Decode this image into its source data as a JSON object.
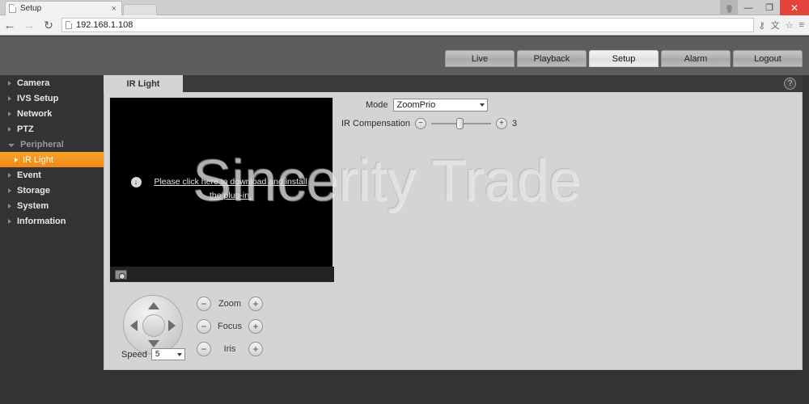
{
  "browser": {
    "tab_title": "Setup",
    "tab_close": "×",
    "url": "192.168.1.108",
    "back_icon": "←",
    "forward_icon": "→",
    "reload_icon": "↻",
    "minimize_icon": "—",
    "maximize_icon": "❐",
    "close_icon": "✕",
    "key_icon": "⚷",
    "translate_icon": "文",
    "star_icon": "☆",
    "menu_icon": "≡"
  },
  "device": {
    "logo": "",
    "topnav": [
      {
        "label": "Live",
        "active": false
      },
      {
        "label": "Playback",
        "active": false
      },
      {
        "label": "Setup",
        "active": true
      },
      {
        "label": "Alarm",
        "active": false
      },
      {
        "label": "Logout",
        "active": false
      }
    ],
    "help_icon": "?"
  },
  "sidebar": {
    "items": [
      {
        "label": "Camera",
        "type": "parent"
      },
      {
        "label": "IVS Setup",
        "type": "parent"
      },
      {
        "label": "Network",
        "type": "parent"
      },
      {
        "label": "PTZ",
        "type": "parent"
      },
      {
        "label": "Peripheral",
        "type": "expanded"
      },
      {
        "label": "IR Light",
        "type": "child-selected"
      },
      {
        "label": "Event",
        "type": "parent"
      },
      {
        "label": "Storage",
        "type": "parent"
      },
      {
        "label": "System",
        "type": "parent"
      },
      {
        "label": "Information",
        "type": "parent"
      }
    ]
  },
  "content": {
    "tab_label": "IR Light",
    "video": {
      "plugin_message": "Please click here to download and install the plug-in.",
      "download_icon": "↓",
      "snapshot_icon": "snapshot"
    },
    "settings": {
      "mode_label": "Mode",
      "mode_value": "ZoomPrio",
      "ir_compensation_label": "IR Compensation",
      "ir_compensation_value": "3",
      "minus_icon": "−",
      "plus_icon": "+"
    },
    "ptz": {
      "speed_label": "Speed",
      "speed_value": "5",
      "controls": [
        {
          "label": "Zoom"
        },
        {
          "label": "Focus"
        },
        {
          "label": "Iris"
        }
      ],
      "minus_icon": "−",
      "plus_icon": "+"
    }
  },
  "watermark": {
    "text": "Sincerity Trade"
  },
  "colors": {
    "accent": "#f08a12",
    "sidebar_bg": "#333333",
    "panel_bg": "#d4d4d4",
    "header_bg": "#5d5d5d",
    "close_button": "#e5413d"
  }
}
